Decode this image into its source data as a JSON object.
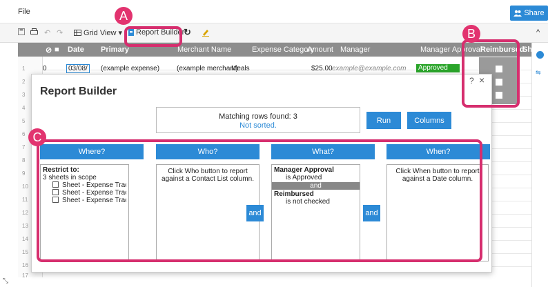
{
  "menu": {
    "file": "File",
    "share": "Share"
  },
  "toolbar": {
    "grid_view": "Grid View",
    "report_builder": "Report Builder"
  },
  "columns": [
    "Date",
    "Primary",
    "Merchant Name",
    "Expense Category",
    "Amount",
    "Manager",
    "Manager Approval",
    "Reimbursed",
    "Sh"
  ],
  "row1": {
    "num": "1",
    "count": "0",
    "date": "03/08/",
    "primary": "(example expense)",
    "merchant": "(example merchant)",
    "category": "Meals",
    "amount": "$25.00",
    "manager": "example@example.com",
    "approval": "Approved"
  },
  "row_numbers": [
    "1",
    "2",
    "3",
    "4",
    "5",
    "6",
    "7",
    "8",
    "9",
    "10",
    "11",
    "12",
    "13",
    "14",
    "15",
    "16",
    "17"
  ],
  "dialog": {
    "title": "Report Builder",
    "help": "?",
    "close": "×",
    "matching": "Matching rows found: 3",
    "sorted": "Not sorted.",
    "run": "Run",
    "columns": "Columns",
    "where_label": "Where?",
    "who_label": "Who?",
    "what_label": "What?",
    "when_label": "When?",
    "and": "and",
    "where": {
      "restrict": "Restrict to:",
      "scope": "3 sheets in scope",
      "sheets": [
        "Sheet - Expense Tracke",
        "Sheet - Expense Tracke",
        "Sheet - Expense Tracke"
      ]
    },
    "who_text": "Click Who button to report against a Contact List column.",
    "what": {
      "c1_title": "Manager Approval",
      "c1_val": "is Approved",
      "and": "and",
      "c2_title": "Reimbursed",
      "c2_val": "is not checked"
    },
    "when_text": "Click When button to report against a Date column."
  },
  "callouts": {
    "a": "A",
    "b": "B",
    "c": "C"
  },
  "colors": {
    "accent": "#2c8ad6",
    "callout": "#d62e6e",
    "approved": "#2aa52a"
  }
}
